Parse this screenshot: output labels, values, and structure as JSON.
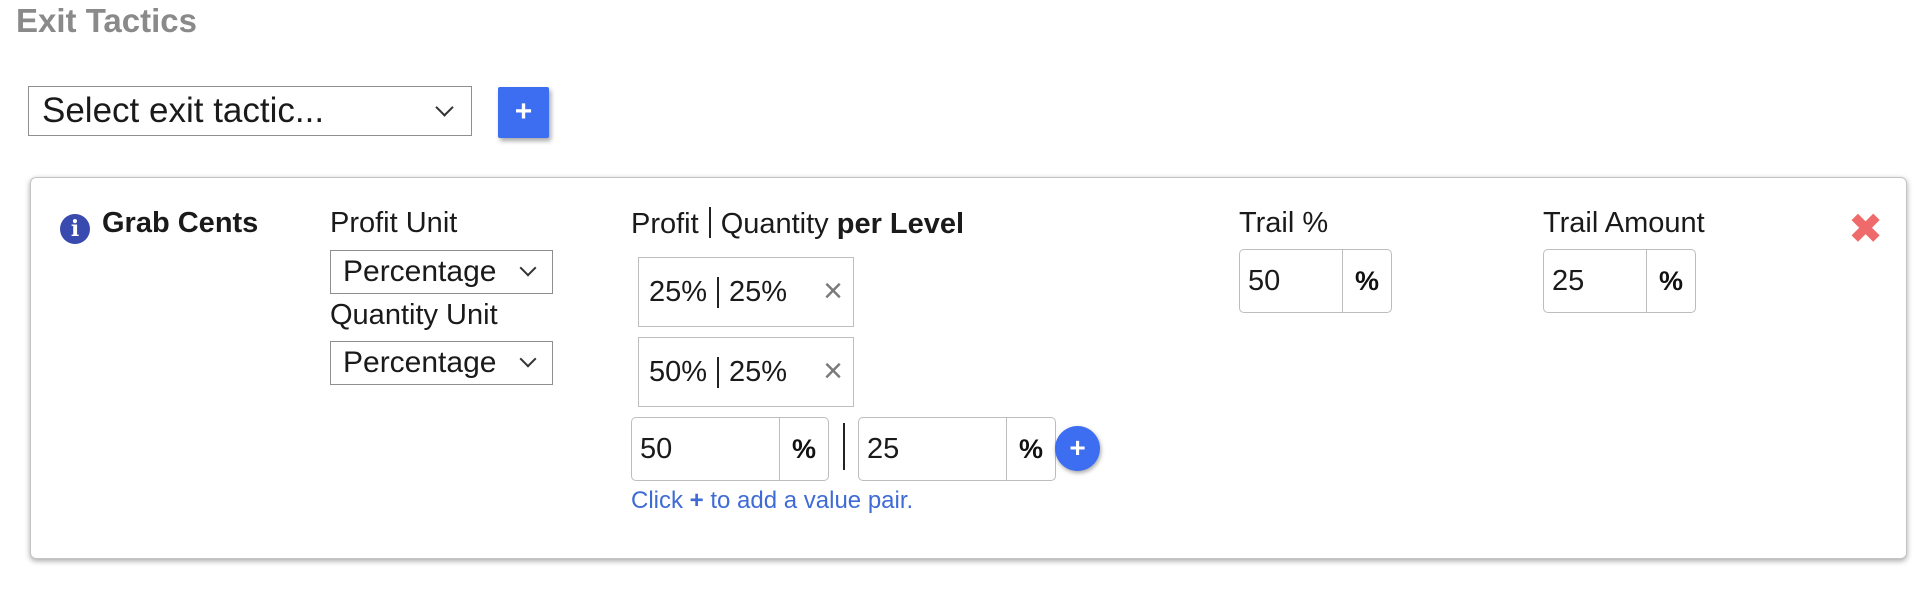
{
  "section": {
    "title": "Exit Tactics"
  },
  "tactic_picker": {
    "selected": "Select exit tactic...",
    "add_label": "+"
  },
  "tactic": {
    "name": "Grab Cents",
    "info_glyph": "i",
    "profit_unit": {
      "label": "Profit Unit",
      "value": "Percentage"
    },
    "quantity_unit": {
      "label": "Quantity Unit",
      "value": "Percentage"
    },
    "levels": {
      "heading": {
        "profit": "Profit",
        "quantity": "Quantity",
        "suffix": "per Level"
      },
      "pairs": [
        {
          "profit": "25%",
          "quantity": "25%"
        },
        {
          "profit": "50%",
          "quantity": "25%"
        }
      ],
      "new_profit": {
        "value": "50",
        "unit": "%"
      },
      "new_quantity": {
        "value": "25",
        "unit": "%"
      },
      "add_label": "+",
      "hint": {
        "prefix": "Click",
        "plus": "+",
        "suffix": "to add a value pair."
      }
    },
    "trail_percent": {
      "label": "Trail %",
      "value": "50",
      "unit": "%"
    },
    "trail_amount": {
      "label": "Trail Amount",
      "value": "25",
      "unit": "%"
    },
    "remove_glyph": "✖",
    "pair_remove_glyph": "×"
  },
  "colors": {
    "accent": "#3d6ef2",
    "danger": "#ef6a6a",
    "info": "#3a4bb0",
    "hint": "#3f6bd6"
  }
}
